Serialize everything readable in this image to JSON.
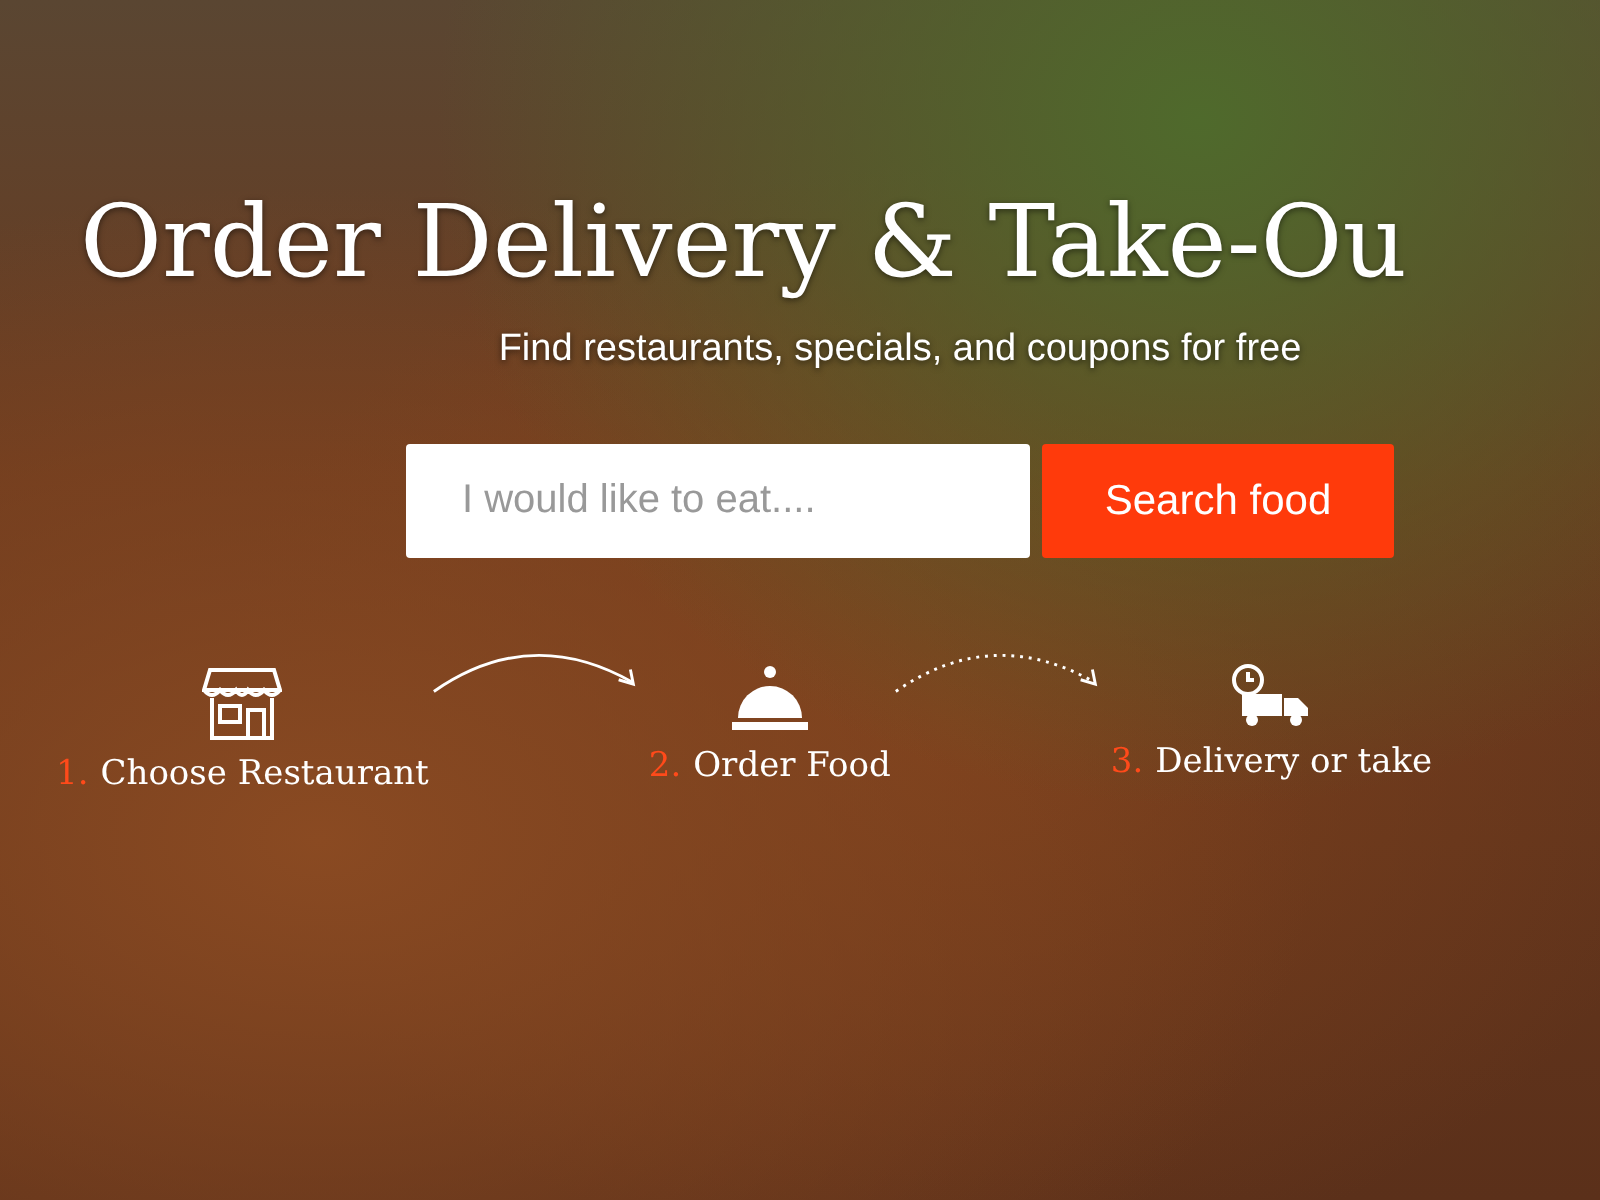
{
  "hero": {
    "title": "Order Delivery & Take-Ou",
    "subtitle": "Find restaurants, specials, and coupons for free"
  },
  "search": {
    "placeholder": "I would like to eat....",
    "button": "Search food"
  },
  "steps": [
    {
      "kind": "store",
      "number": "1.",
      "label": "Choose Restaurant"
    },
    {
      "kind": "cloche",
      "number": "2.",
      "label": "Order Food"
    },
    {
      "kind": "truck",
      "number": "3.",
      "label": "Delivery or take"
    }
  ],
  "connectors": [
    {
      "kind": "solid"
    },
    {
      "kind": "dotted"
    }
  ]
}
